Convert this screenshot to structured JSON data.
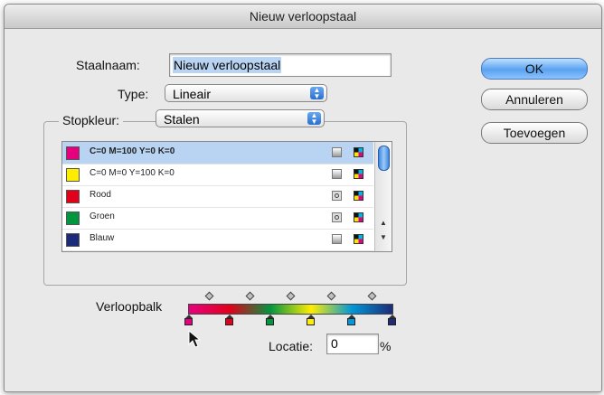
{
  "dialog": {
    "title": "Nieuw verloopstaal",
    "name_label": "Staalnaam:",
    "name_value": "Nieuw verloopstaal",
    "type_label": "Type:",
    "type_value": "Lineair",
    "stop_color_label": "Stopkleur:",
    "stop_color_value": "Stalen",
    "buttons": {
      "ok": "OK",
      "cancel": "Annuleren",
      "add": "Toevoegen"
    }
  },
  "swatches": [
    {
      "name": "C=0 M=100 Y=0 K=0",
      "color": "#e6007e",
      "selected": true,
      "mode_icon": "process-color-icon"
    },
    {
      "name": "C=0 M=0 Y=100 K=0",
      "color": "#ffed00",
      "selected": false,
      "mode_icon": "process-color-icon"
    },
    {
      "name": "Rood",
      "color": "#e2001a",
      "selected": false,
      "mode_icon": "spot-color-icon"
    },
    {
      "name": "Groen",
      "color": "#009640",
      "selected": false,
      "mode_icon": "spot-color-icon"
    },
    {
      "name": "Blauw",
      "color": "#1d2c7a",
      "selected": false,
      "mode_icon": "process-color-icon"
    }
  ],
  "gradient": {
    "label": "Verloopbalk",
    "stops": [
      {
        "color": "#e6007e",
        "location": 0
      },
      {
        "color": "#e2001a",
        "location": 20
      },
      {
        "color": "#009640",
        "location": 40
      },
      {
        "color": "#ffed00",
        "location": 60
      },
      {
        "color": "#0098d8",
        "location": 80
      },
      {
        "color": "#1d2c7a",
        "location": 100
      }
    ],
    "midpoints": [
      10,
      30,
      50,
      70,
      90
    ],
    "location_label": "Locatie:",
    "location_value": "0",
    "location_unit": "%"
  }
}
